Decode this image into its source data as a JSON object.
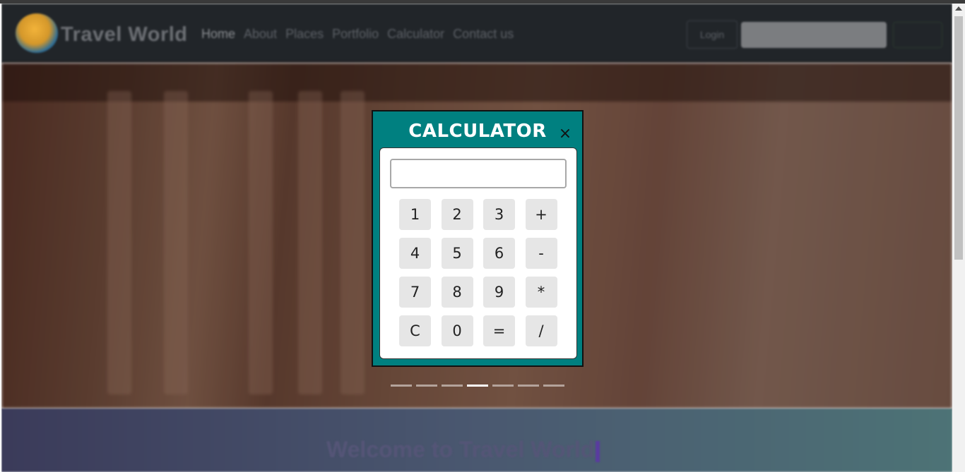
{
  "navbar": {
    "brand": "Travel World",
    "links": [
      "Home",
      "About",
      "Places",
      "Portfolio",
      "Calculator",
      "Contact us"
    ],
    "login_label": "Login"
  },
  "carousel": {
    "slide_count": 7,
    "active_index": 3
  },
  "welcome_text": "Welcome to Travel World",
  "calculator": {
    "title": "CALCULATOR",
    "close_symbol": "×",
    "display_value": "",
    "keys": [
      "1",
      "2",
      "3",
      "+",
      "4",
      "5",
      "6",
      "-",
      "7",
      "8",
      "9",
      "*",
      "C",
      "0",
      "=",
      "/"
    ]
  },
  "colors": {
    "modal_bg": "#008080",
    "navbar_bg": "#212529",
    "key_bg": "#e6e6e6"
  }
}
